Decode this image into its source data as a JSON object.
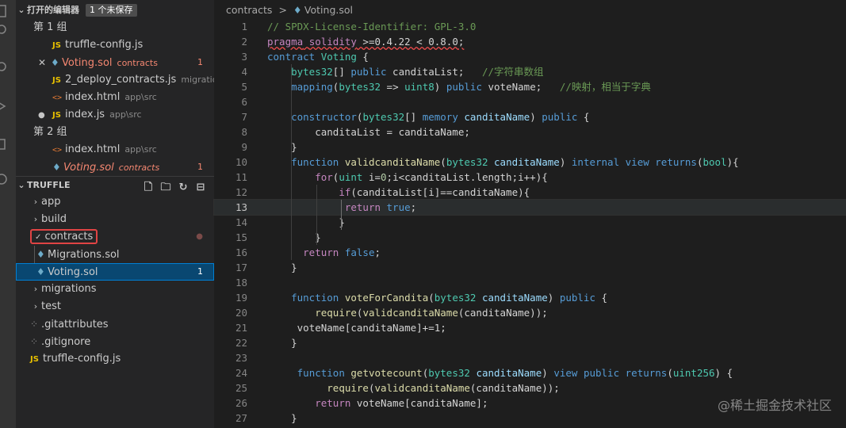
{
  "open_editors": {
    "title": "打开的编辑器",
    "unsaved_badge": "1 个未保存",
    "groups": [
      {
        "label": "第 1 组",
        "items": [
          {
            "icon": "JS",
            "name": "truffle-config.js",
            "desc": ""
          },
          {
            "icon": "sol",
            "name": "Voting.sol",
            "desc": "contracts",
            "count": "1",
            "close": "✕"
          },
          {
            "icon": "JS",
            "name": "2_deploy_contracts.js",
            "desc": "migrations"
          },
          {
            "icon": "<>",
            "name": "index.html",
            "desc": "app\\src"
          },
          {
            "icon": "JS",
            "name": "index.js",
            "desc": "app\\src",
            "dot": "●"
          }
        ]
      },
      {
        "label": "第 2 组",
        "items": [
          {
            "icon": "<>",
            "name": "index.html",
            "desc": "app\\src"
          },
          {
            "icon": "sol",
            "name": "Voting.sol",
            "desc": "contracts",
            "count": "1"
          }
        ]
      }
    ]
  },
  "explorer": {
    "title": "TRUFFLE",
    "tree": [
      {
        "name": "app",
        "chevron": "›"
      },
      {
        "name": "build",
        "chevron": "›"
      },
      {
        "name": "contracts",
        "chevron": "✓"
      },
      {
        "name": "Migrations.sol"
      },
      {
        "name": "Voting.sol",
        "count": "1"
      },
      {
        "name": "migrations",
        "chevron": "›"
      },
      {
        "name": "test",
        "chevron": "›"
      },
      {
        "name": ".gitattributes"
      },
      {
        "name": ".gitignore"
      },
      {
        "name": "truffle-config.js",
        "icon": "JS"
      }
    ]
  },
  "breadcrumb": {
    "folder": "contracts",
    "separator": ">",
    "file": "Voting.sol"
  },
  "code_lines": [
    "1",
    "2",
    "3",
    "4",
    "5",
    "6",
    "7",
    "8",
    "9",
    "10",
    "11",
    "12",
    "13",
    "14",
    "15",
    "16",
    "17",
    "18",
    "19",
    "20",
    "21",
    "22",
    "23",
    "24",
    "25",
    "26",
    "27"
  ],
  "code": {
    "l1": "// SPDX-License-Identifier: GPL-3.0",
    "l2_a": "pragma",
    "l2_b": "solidity",
    "l2_c": " >=0.4.22 < 0.8.0;",
    "l3_a": "contract",
    "l3_b": "Voting",
    "l3_c": " {",
    "l4_a": "bytes32",
    "l4_b": "[] ",
    "l4_c": "public",
    "l4_d": " canditaList;",
    "l4_e": "//字符串数组",
    "l5_a": "mapping",
    "l5_b": "(",
    "l5_c": "bytes32",
    "l5_d": " => ",
    "l5_e": "uint8",
    "l5_f": ") ",
    "l5_g": "public",
    "l5_h": " voteName;",
    "l5_i": "//映射，相当于字典",
    "l7_a": "constructor",
    "l7_b": "(",
    "l7_c": "bytes32",
    "l7_d": "[] ",
    "l7_e": "memory",
    "l7_f": "canditaName",
    "l7_g": ") ",
    "l7_h": "public",
    "l7_i": " {",
    "l8": "canditaList = canditaName;",
    "l9": "}",
    "l10_a": "function",
    "l10_b": "validcanditaName",
    "l10_c": "(",
    "l10_d": "bytes32",
    "l10_e": "canditaName",
    "l10_f": ") ",
    "l10_g": "internal",
    "l10_h": "view",
    "l10_i": "returns",
    "l10_j": "(",
    "l10_k": "bool",
    "l10_l": "){",
    "l11_a": "for",
    "l11_b": "(",
    "l11_c": "uint",
    "l11_d": " i=",
    "l11_e": "0",
    "l11_f": ";i<canditaList.length;i++){",
    "l12_a": "if",
    "l12_b": "(canditaList[i]==canditaName){",
    "l13_a": "return",
    "l13_b": "true",
    "l13_c": ";",
    "l14": "}",
    "l15": "}",
    "l16_a": "return",
    "l16_b": "false",
    "l16_c": ";",
    "l17": "}",
    "l19_a": "function",
    "l19_b": "voteForCandita",
    "l19_c": "(",
    "l19_d": "bytes32",
    "l19_e": "canditaName",
    "l19_f": ") ",
    "l19_g": "public",
    "l19_h": " {",
    "l20_a": "require",
    "l20_b": "(",
    "l20_c": "validcanditaName",
    "l20_d": "(canditaName));",
    "l21": "voteName[canditaName]+=1;",
    "l22": "}",
    "l24_a": "function",
    "l24_b": "getvotecount",
    "l24_c": "(",
    "l24_d": "bytes32",
    "l24_e": "canditaName",
    "l24_f": ") ",
    "l24_g": "view",
    "l24_h": "public",
    "l24_i": "returns",
    "l24_j": "(",
    "l24_k": "uint256",
    "l24_l": ") {",
    "l25_a": "require",
    "l25_b": "(",
    "l25_c": "validcanditaName",
    "l25_d": "(canditaName));",
    "l26_a": "return",
    "l26_b": " voteName[canditaName];",
    "l27": "}"
  },
  "watermark": "@稀土掘金技术社区",
  "colors": {
    "accent": "#007fd4",
    "error": "#f48771",
    "annotation": "#e04444"
  }
}
